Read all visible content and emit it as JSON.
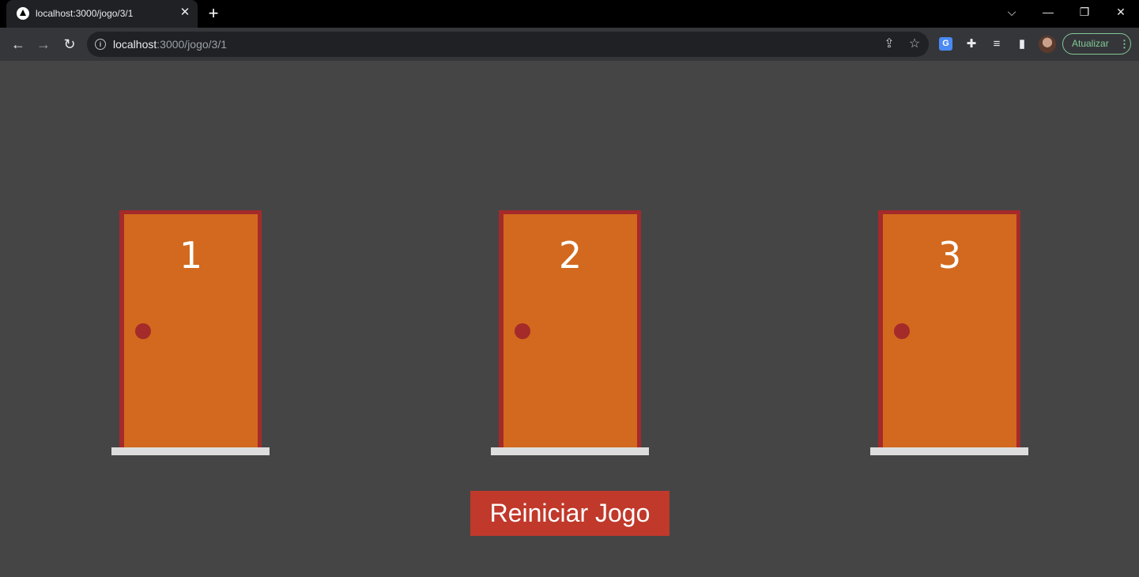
{
  "browser": {
    "tab": {
      "title": "localhost:3000/jogo/3/1",
      "close_glyph": "✕",
      "favicon": "triangle-logo-icon"
    },
    "new_tab_glyph": "+",
    "window_controls": {
      "tab_search": "⌵",
      "minimize": "—",
      "restore": "❐",
      "close": "✕"
    },
    "nav": {
      "back": "←",
      "forward": "→",
      "reload": "↻"
    },
    "address": {
      "host": "localhost",
      "path": ":3000/jogo/3/1",
      "info_glyph": "i"
    },
    "omnibox_icons": {
      "share": "⇪",
      "bookmark": "☆"
    },
    "extensions": {
      "translate": "G",
      "puzzle": "✚",
      "media": "≡",
      "side_panel": "▮"
    },
    "update_button": {
      "label": "Atualizar",
      "menu_glyph": "⋮"
    }
  },
  "colors": {
    "page_background": "#454545",
    "door_frame": "#a52a2a",
    "door": "#d2691e",
    "floor": "#dddddd",
    "button": "#c0392b"
  },
  "doors": [
    {
      "number": "1"
    },
    {
      "number": "2"
    },
    {
      "number": "3"
    }
  ],
  "restart_button": {
    "label": "Reiniciar Jogo"
  }
}
